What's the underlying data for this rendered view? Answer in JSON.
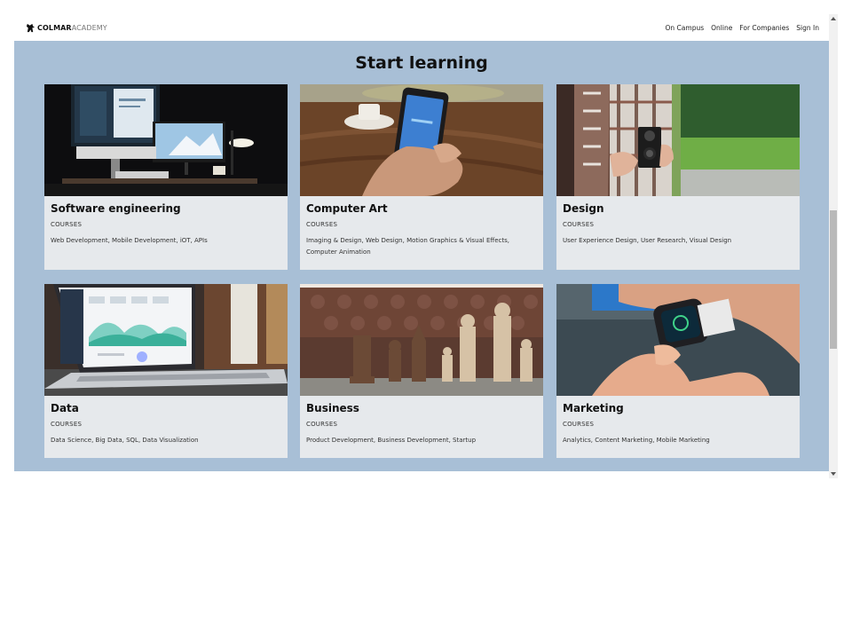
{
  "header": {
    "logo_bold": "COLMAR",
    "logo_light": "ACADEMY",
    "nav": [
      "On Campus",
      "Online",
      "For Companies",
      "Sign In"
    ]
  },
  "main": {
    "title": "Start learning",
    "cards": [
      {
        "title": "Software engineering",
        "kind": "COURSES",
        "desc": "Web Development, Mobile Development, iOT, APIs"
      },
      {
        "title": "Computer Art",
        "kind": "COURSES",
        "desc": "Imaging & Design, Web Design, Motion Graphics & Visual Effects, Computer Animation"
      },
      {
        "title": "Design",
        "kind": "COURSES",
        "desc": "User Experience Design, User Research, Visual Design"
      },
      {
        "title": "Data",
        "kind": "COURSES",
        "desc": "Data Science, Big Data, SQL, Data Visualization"
      },
      {
        "title": "Business",
        "kind": "COURSES",
        "desc": "Product Development, Business Development, Startup"
      },
      {
        "title": "Marketing",
        "kind": "COURSES",
        "desc": "Analytics, Content Marketing, Mobile Marketing"
      }
    ]
  },
  "colors": {
    "section_bg": "#a8bfd6",
    "card_bg": "#e6e9ec"
  }
}
